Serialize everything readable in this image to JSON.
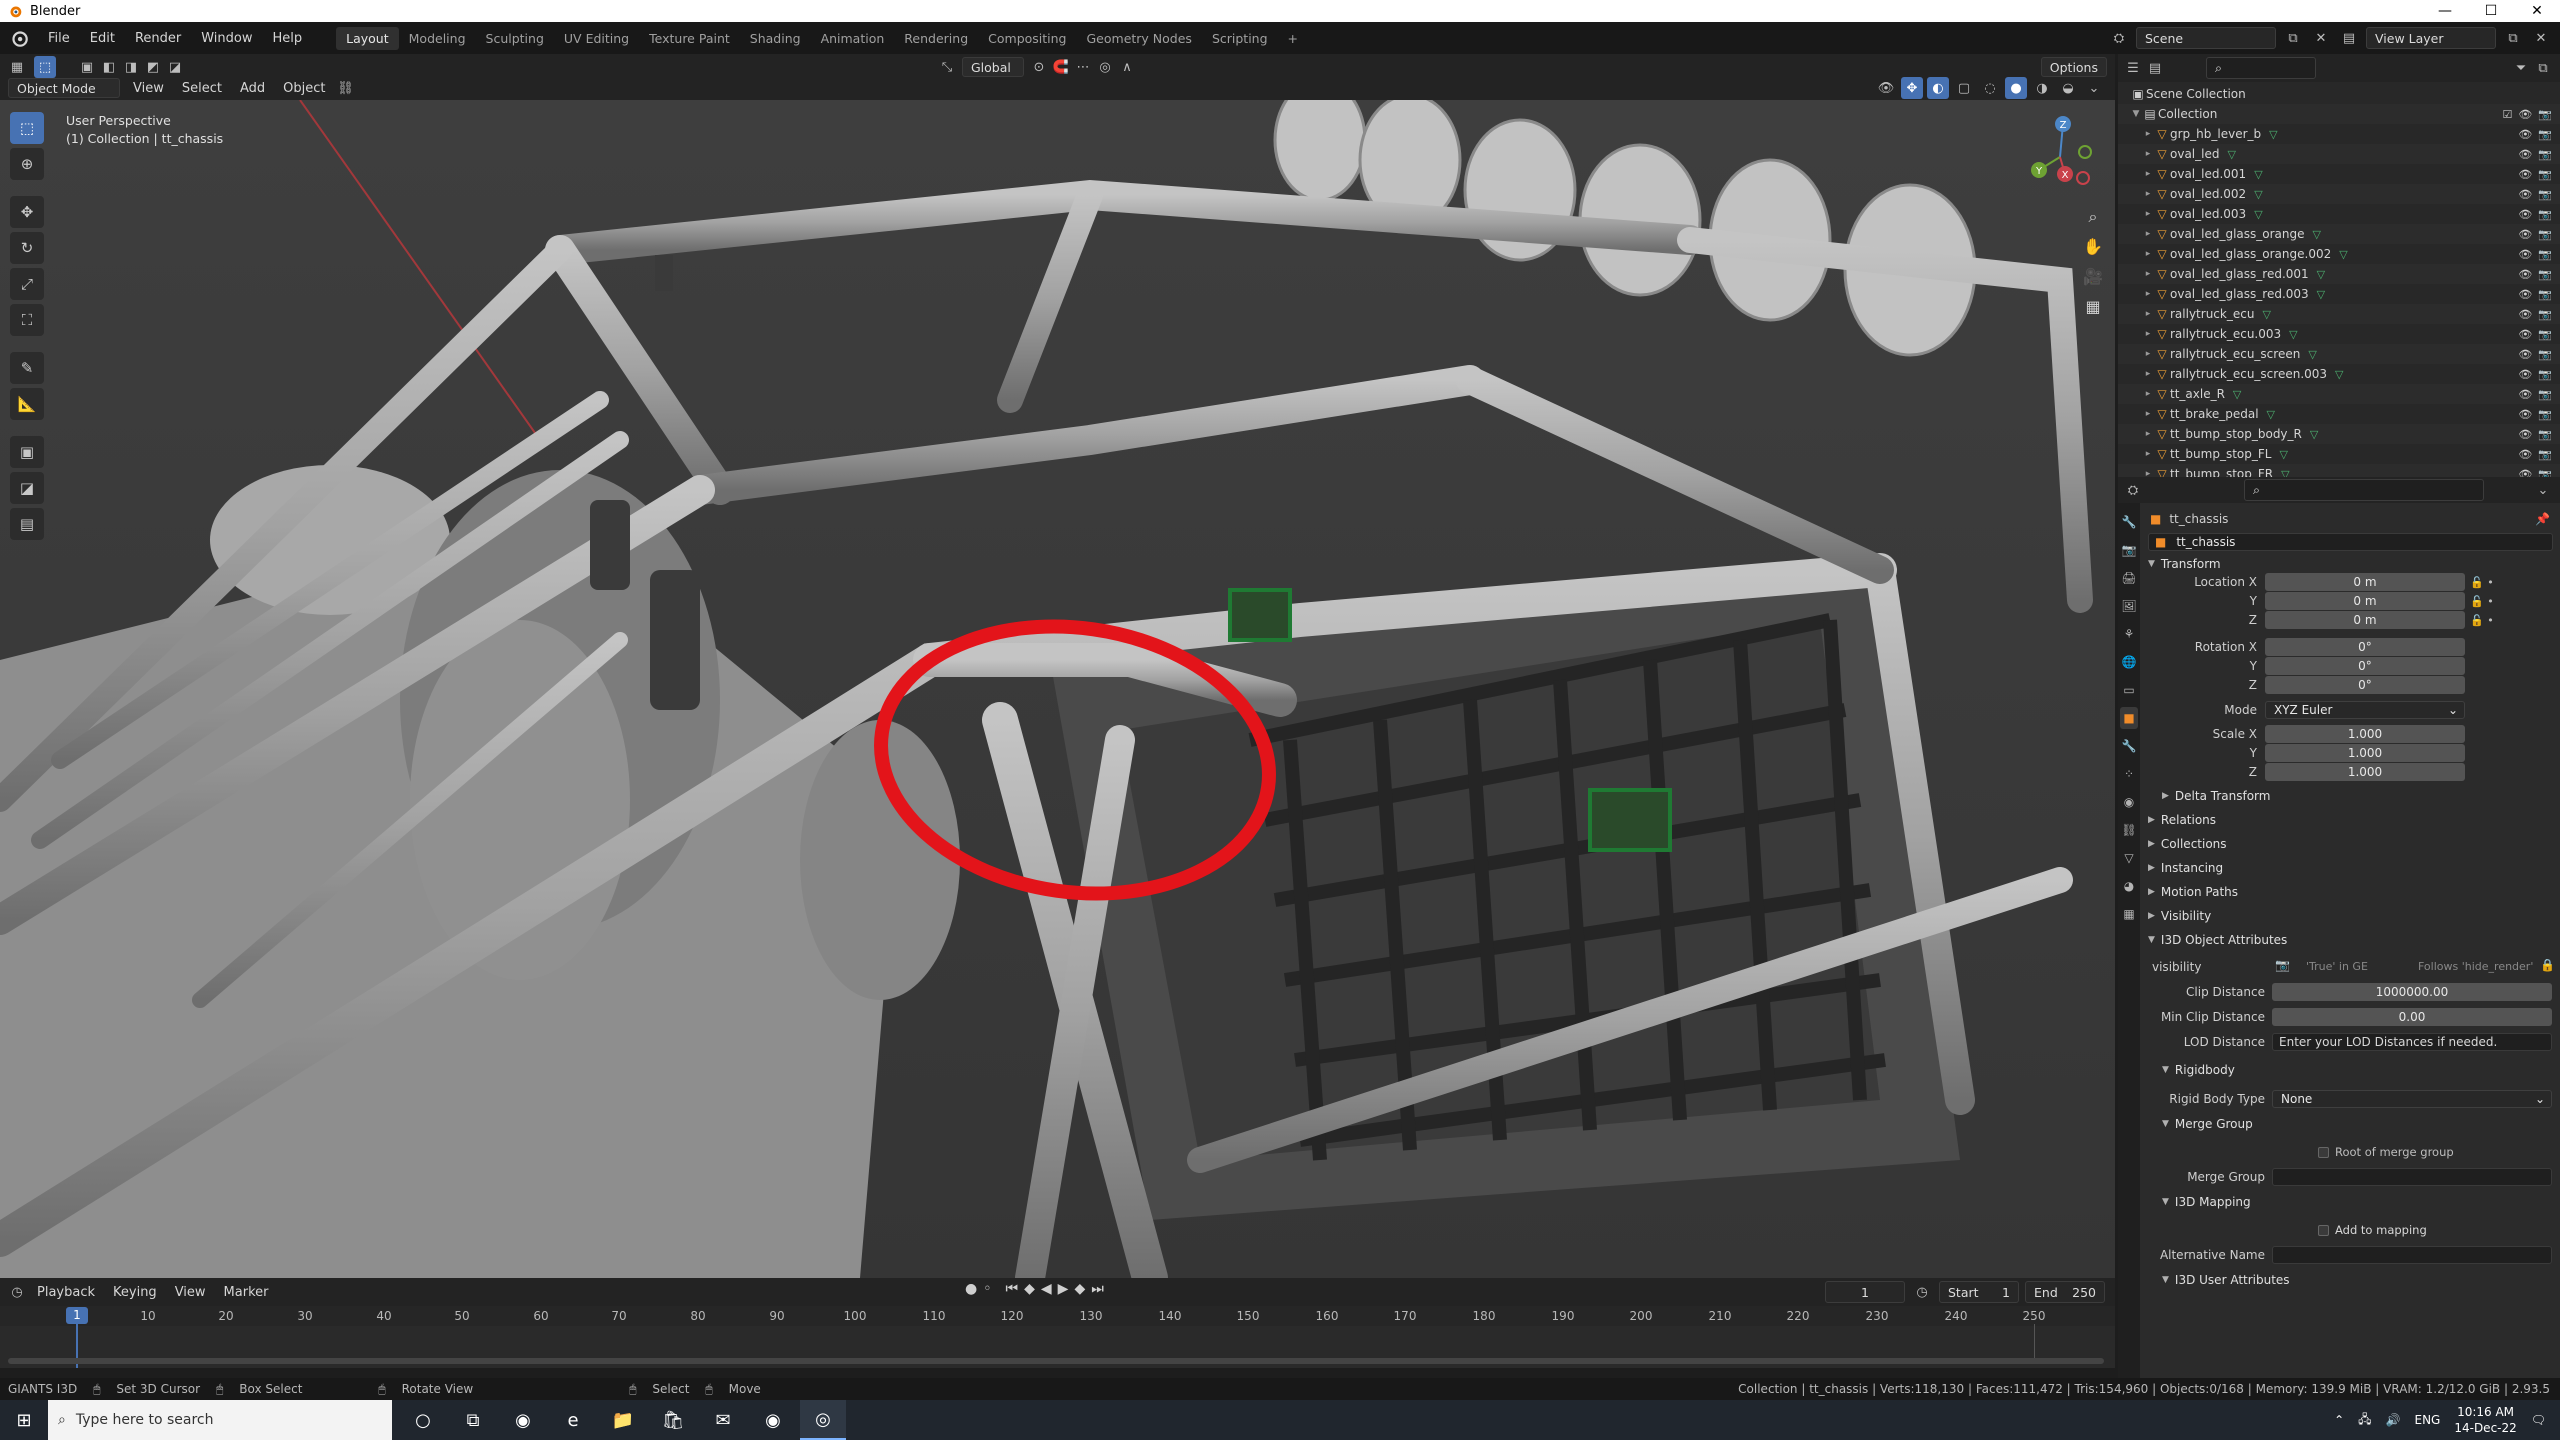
{
  "window": {
    "title": "Blender",
    "controls": [
      "—",
      "☐",
      "✕"
    ]
  },
  "menu": [
    "File",
    "Edit",
    "Render",
    "Window",
    "Help"
  ],
  "workspaces": {
    "tabs": [
      "Layout",
      "Modeling",
      "Sculpting",
      "UV Editing",
      "Texture Paint",
      "Shading",
      "Animation",
      "Rendering",
      "Compositing",
      "Geometry Nodes",
      "Scripting"
    ],
    "active": "Layout",
    "add": "+"
  },
  "topbar_right": {
    "scene": "Scene",
    "view_layer": "View Layer"
  },
  "viewport_header": {
    "transform_orientation": "Global",
    "options": "Options",
    "mode": "Object Mode",
    "menus": [
      "View",
      "Select",
      "Add",
      "Object"
    ]
  },
  "viewport": {
    "perspective": "User Perspective",
    "collection_info": "(1) Collection | tt_chassis",
    "gizmo": {
      "x": "X",
      "y": "Y",
      "z": "Z"
    }
  },
  "timeline": {
    "menus": [
      "Playback",
      "Keying",
      "View",
      "Marker"
    ],
    "current_frame": "1",
    "start_label": "Start",
    "start": "1",
    "end_label": "End",
    "end": "250",
    "ticks": [
      "10",
      "20",
      "30",
      "40",
      "50",
      "60",
      "70",
      "80",
      "90",
      "100",
      "110",
      "120",
      "130",
      "140",
      "150",
      "160",
      "170",
      "180",
      "190",
      "200",
      "210",
      "220",
      "230",
      "240",
      "250"
    ]
  },
  "statusbar": {
    "plugin": "GIANTS I3D",
    "hints": [
      "Set 3D Cursor",
      "Box Select",
      "Rotate View",
      "Select",
      "Move"
    ],
    "stats": "Collection | tt_chassis | Verts:118,130 | Faces:111,472 | Tris:154,960 | Objects:0/168 | Memory: 139.9 MiB | VRAM: 1.2/12.0 GiB | 2.93.5"
  },
  "outliner": {
    "root": "Scene Collection",
    "collection": "Collection",
    "items": [
      "grp_hb_lever_b",
      "oval_led",
      "oval_led.001",
      "oval_led.002",
      "oval_led.003",
      "oval_led_glass_orange",
      "oval_led_glass_orange.002",
      "oval_led_glass_red.001",
      "oval_led_glass_red.003",
      "rallytruck_ecu",
      "rallytruck_ecu.003",
      "rallytruck_ecu_screen",
      "rallytruck_ecu_screen.003",
      "tt_axle_R",
      "tt_brake_pedal",
      "tt_bump_stop_body_R",
      "tt_bump_stop_FL",
      "tt_bump_stop_FR"
    ]
  },
  "properties": {
    "object_name": "tt_chassis",
    "data_name": "tt_chassis",
    "transform": {
      "title": "Transform",
      "location_label": "Location X",
      "location": [
        "0 m",
        "0 m",
        "0 m"
      ],
      "rotation_label": "Rotation X",
      "rotation": [
        "0°",
        "0°",
        "0°"
      ],
      "mode_label": "Mode",
      "mode": "XYZ Euler",
      "scale_label": "Scale X",
      "scale": [
        "1.000",
        "1.000",
        "1.000"
      ],
      "axis_y": "Y",
      "axis_z": "Z"
    },
    "sections": [
      "Delta Transform",
      "Relations",
      "Collections",
      "Instancing",
      "Motion Paths",
      "Visibility",
      "I3D Object Attributes"
    ],
    "i3d": {
      "visibility_label": "visibility",
      "visibility_true": "'True' in GE",
      "visibility_follows": "Follows 'hide_render'",
      "clip_distance_label": "Clip Distance",
      "clip_distance": "1000000.00",
      "min_clip_distance_label": "Min Clip Distance",
      "min_clip_distance": "0.00",
      "lod_distance_label": "LOD Distance",
      "lod_distance_placeholder": "Enter your LOD Distances if needed.",
      "rigidbody_title": "Rigidbody",
      "rigid_body_type_label": "Rigid Body Type",
      "rigid_body_type": "None",
      "merge_group_title": "Merge Group",
      "root_of_merge_group": "Root of merge group",
      "merge_group_label": "Merge Group",
      "i3d_mapping_title": "I3D Mapping",
      "add_to_mapping": "Add to mapping",
      "alternative_name_label": "Alternative Name",
      "user_attributes_title": "I3D User Attributes"
    }
  },
  "taskbar": {
    "search_placeholder": "Type here to search",
    "language": "ENG",
    "time": "10:16 AM",
    "date": "14-Dec-22"
  }
}
